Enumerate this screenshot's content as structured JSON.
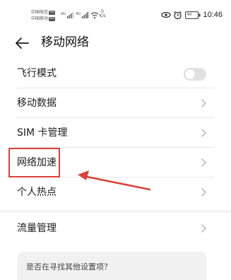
{
  "status_bar": {
    "carrier_1": "中国电信",
    "carrier_2": "中国移动",
    "hd_badge": "HD",
    "signal_1": "4G",
    "signal_2": "4G",
    "net_speed_value": "0",
    "net_speed_unit": "K/s",
    "battery_level": "40",
    "time": "10:46",
    "icons": [
      "eye-comfort-icon",
      "alarm-icon",
      "battery-icon",
      "wifi-icon",
      "signal-icon"
    ]
  },
  "header": {
    "title": "移动网络",
    "back_icon": "back-arrow-icon"
  },
  "settings": {
    "items": [
      {
        "label": "飞行模式",
        "control": "toggle",
        "toggle_on": false
      },
      {
        "label": "移动数据",
        "control": "chevron"
      },
      {
        "label": "SIM 卡管理",
        "control": "chevron"
      },
      {
        "label": "网络加速",
        "control": "chevron",
        "highlighted": true
      },
      {
        "label": "个人热点",
        "control": "chevron"
      }
    ],
    "section_2": [
      {
        "label": "流量管理",
        "control": "chevron"
      }
    ]
  },
  "suggestion": {
    "text": "是否在寻找其他设置项？"
  },
  "colors": {
    "highlight": "#d9423a",
    "toggle_off": "#e1e1e1",
    "card_bg": "#f1f1f1"
  }
}
